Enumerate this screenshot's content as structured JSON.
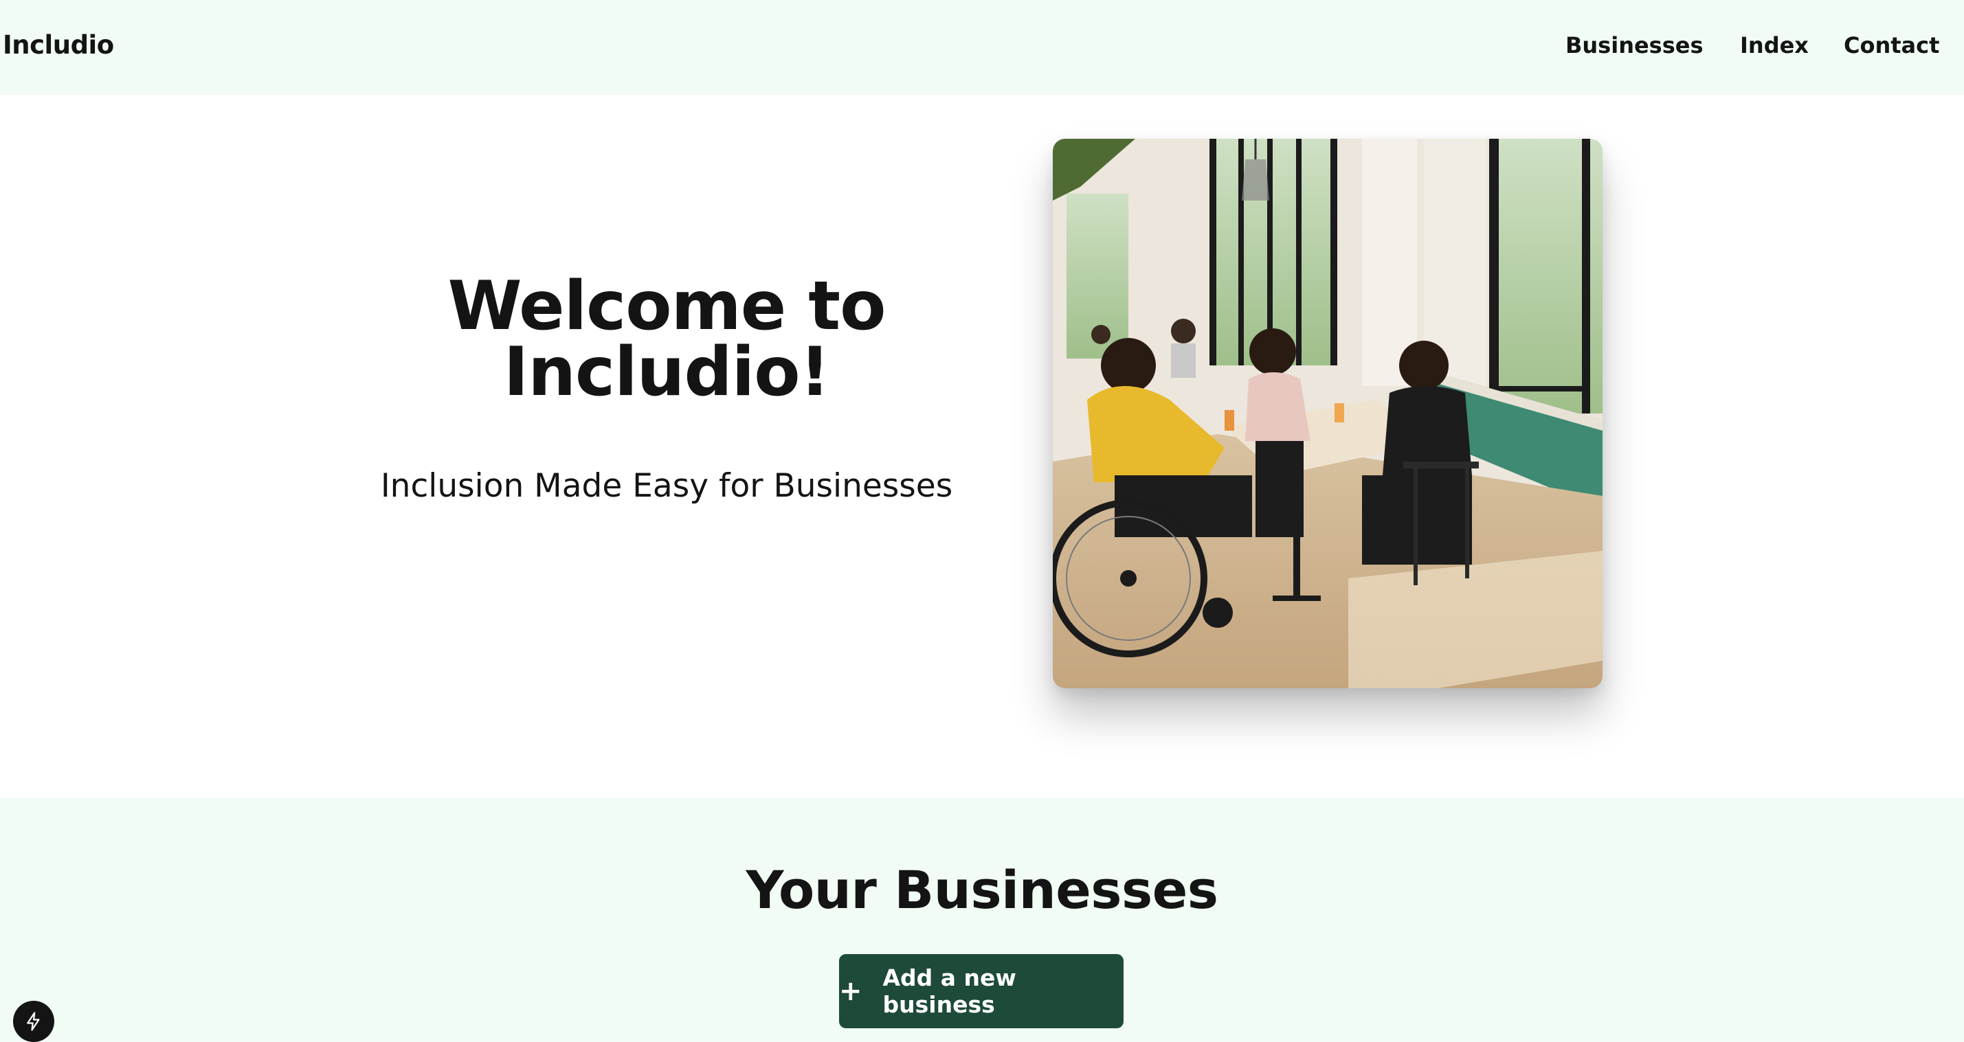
{
  "header": {
    "brand": "Includio",
    "nav": [
      {
        "label": "Businesses"
      },
      {
        "label": "Index"
      },
      {
        "label": "Contact"
      }
    ]
  },
  "hero": {
    "title_line1": "Welcome to",
    "title_line2": "Includio!",
    "subtitle": "Inclusion Made Easy for Businesses",
    "image_description": "people-dining-cafe-photo"
  },
  "businesses": {
    "title": "Your Businesses",
    "add_button": {
      "label": "Add a new business",
      "icon": "plus-icon"
    }
  },
  "dev_badge": {
    "icon": "lightning-icon"
  },
  "colors": {
    "header_bg": "#f0fcf4",
    "section_bg": "#f0fcf4",
    "button_bg": "#1e4a39",
    "text": "#141414"
  }
}
